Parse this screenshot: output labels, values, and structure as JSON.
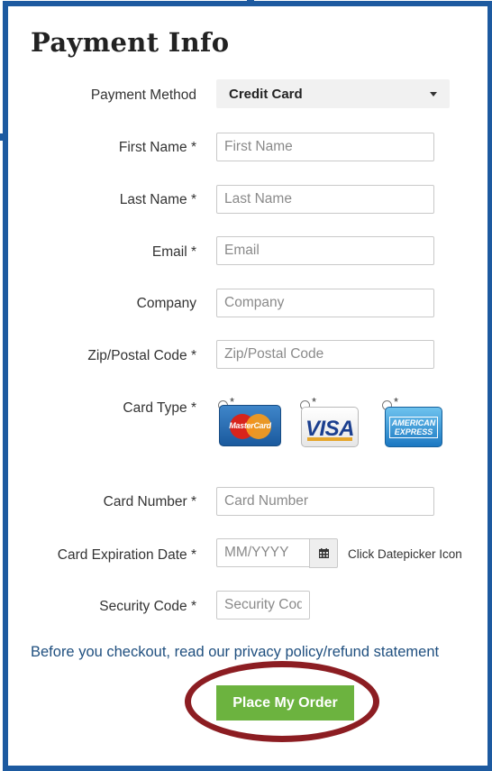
{
  "form": {
    "title": "Payment Info",
    "payment_method": {
      "label": "Payment Method",
      "value": "Credit Card"
    },
    "first_name": {
      "label": "First Name *",
      "placeholder": "First Name"
    },
    "last_name": {
      "label": "Last Name *",
      "placeholder": "Last Name"
    },
    "email": {
      "label": "Email *",
      "placeholder": "Email"
    },
    "company": {
      "label": "Company",
      "placeholder": "Company"
    },
    "zip": {
      "label": "Zip/Postal Code *",
      "placeholder": "Zip/Postal Code"
    },
    "card_type": {
      "label": "Card Type *",
      "options": [
        {
          "mark": "*",
          "brand": "MasterCard"
        },
        {
          "mark": "*",
          "brand": "VISA"
        },
        {
          "mark": "*",
          "brand": "AMERICAN EXPRESS"
        }
      ]
    },
    "card_number": {
      "label": "Card Number *",
      "placeholder": "Card Number"
    },
    "expiration": {
      "label": "Card Expiration Date *",
      "placeholder": "MM/YYYY",
      "hint": "Click Datepicker Icon"
    },
    "security_code": {
      "label": "Security Code *",
      "placeholder": "Security Code"
    },
    "notice": "Before you checkout, read our privacy policy/refund statement",
    "submit_label": "Place My Order"
  },
  "colors": {
    "frame": "#1d5aa0",
    "button": "#6cb33f",
    "highlight_ring": "#8c1d22",
    "notice_text": "#1f4f7f"
  }
}
